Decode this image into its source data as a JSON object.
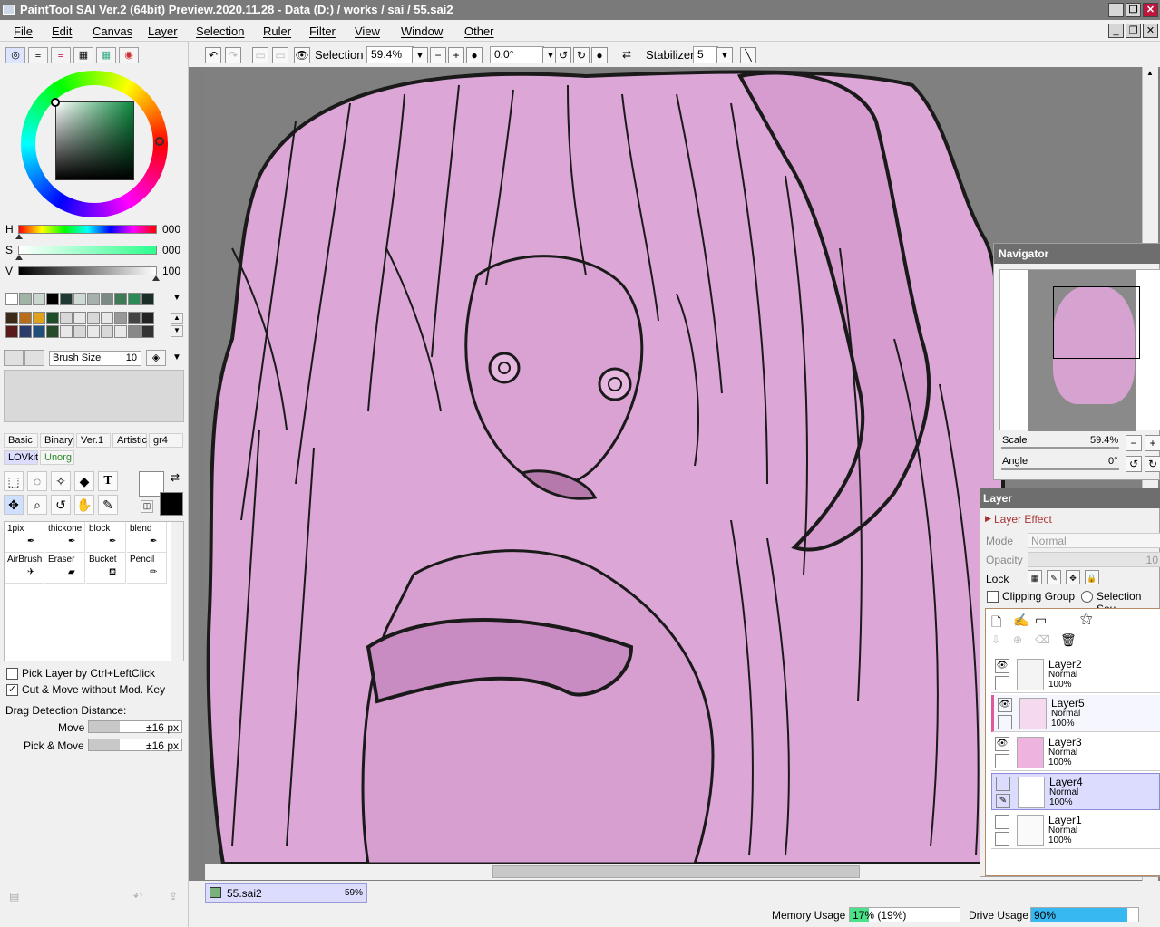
{
  "window": {
    "title": "PaintTool SAI Ver.2 (64bit) Preview.2020.11.28 - Data (D:) / works / sai / 55.sai2"
  },
  "menu": [
    "File",
    "Edit",
    "Canvas",
    "Layer",
    "Selection",
    "Ruler",
    "Filter",
    "View",
    "Window",
    "Other"
  ],
  "color": {
    "h_label": "H",
    "h_value": "000",
    "s_label": "S",
    "s_value": "000",
    "v_label": "V",
    "v_value": "100",
    "swatches_row1": [
      "#ffffff",
      "#9fb3a7",
      "#c9d6ce",
      "#000000",
      "#1f3a32",
      "#cfdad4",
      "#a6b0ac",
      "#7b8a84",
      "#3e7a55",
      "#2b8a55",
      "#1c2e28"
    ],
    "swatches_row2": [
      "#3b2a1a",
      "#b86d1a",
      "#e1a21b",
      "#1f4d2a",
      "#d8d8d8",
      "#e8e8e8",
      "#d8d8d8",
      "#e8e8e8",
      "#999999",
      "#444444",
      "#222222"
    ],
    "swatches_row3": [
      "#5a1a1a",
      "#2a3a6a",
      "#1f4f7a",
      "#264a2a",
      "#e8e8e8",
      "#d8d8d8",
      "#e8e8e8",
      "#d8d8d8",
      "#e8e8e8",
      "#888888",
      "#333333"
    ]
  },
  "brush_size": {
    "label": "Brush Size",
    "value": "10"
  },
  "tool_tabs": [
    "Basic",
    "Binary",
    "Ver.1",
    "Artistic",
    "gr4",
    "LOVkit",
    "Unorg"
  ],
  "brushes": [
    "1pix",
    "thickone",
    "block",
    "blend",
    "AirBrush",
    "Eraser",
    "Bucket",
    "Pencil"
  ],
  "options": {
    "pick_layer": "Pick Layer by Ctrl+LeftClick",
    "cut_move": "Cut & Move without Mod. Key",
    "drag_detect": "Drag Detection Distance:",
    "move_label": "Move",
    "move_value": "±16 px",
    "pick_move_label": "Pick & Move",
    "pick_move_value": "±16 px"
  },
  "toolbar": {
    "selection_label": "Selection",
    "zoom": "59.4%",
    "angle": "0.0°",
    "stabilizer_label": "Stabilizer",
    "stabilizer_value": "5"
  },
  "navigator": {
    "title": "Navigator",
    "scale_label": "Scale",
    "scale_value": "59.4%",
    "angle_label": "Angle",
    "angle_value": "0°"
  },
  "layers": {
    "title": "Layer",
    "effect": "Layer Effect",
    "mode_label": "Mode",
    "mode_value": "Normal",
    "opacity_label": "Opacity",
    "opacity_value": "10",
    "lock_label": "Lock",
    "clipping": "Clipping Group",
    "selection_source": "Selection Sou",
    "items": [
      {
        "name": "Layer2",
        "mode": "Normal",
        "opacity": "100%"
      },
      {
        "name": "Layer5",
        "mode": "Normal",
        "opacity": "100%"
      },
      {
        "name": "Layer3",
        "mode": "Normal",
        "opacity": "100%"
      },
      {
        "name": "Layer4",
        "mode": "Normal",
        "opacity": "100%"
      },
      {
        "name": "Layer1",
        "mode": "Normal",
        "opacity": "100%"
      }
    ]
  },
  "document_tab": {
    "name": "55.sai2",
    "zoom": "59%"
  },
  "status": {
    "memory_label": "Memory Usage",
    "memory_value": "17% (19%)",
    "memory_fraction": 0.17,
    "drive_label": "Drive Usage",
    "drive_value": "90%",
    "drive_fraction": 0.9
  }
}
